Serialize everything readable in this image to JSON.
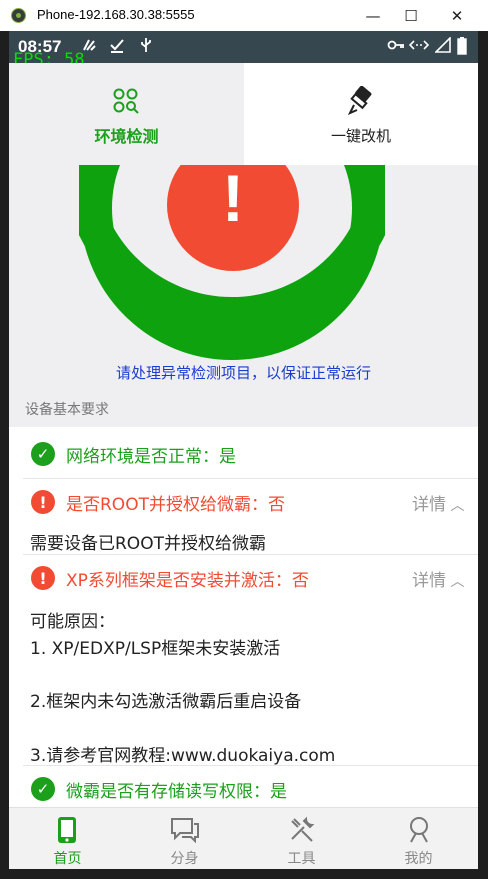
{
  "window": {
    "title": "Phone-192.168.30.38:5555",
    "minimize": "—",
    "maximize": "☐",
    "close": "✕"
  },
  "status_bar": {
    "time": "08:57",
    "fps": "FPS: 58"
  },
  "tabs": [
    {
      "label": "环境检测",
      "icon": "scan-icon",
      "active": true
    },
    {
      "label": "一键改机",
      "icon": "brush-icon",
      "active": false
    }
  ],
  "gauge": {
    "symbol": "!",
    "ring_color": "#0ea20e",
    "alert_color": "#f24b34",
    "message": "请处理异常检测项目，以保证正常运行"
  },
  "section": {
    "title": "设备基本要求"
  },
  "checks": [
    {
      "status": "ok",
      "text": "网络环境是否正常：是"
    },
    {
      "status": "error",
      "text": "是否ROOT并授权给微霸：否",
      "detail_label": "详情",
      "body": [
        "需要设备已ROOT并授权给微霸"
      ]
    },
    {
      "status": "error",
      "text": "XP系列框架是否安装并激活：否",
      "detail_label": "详情",
      "body": [
        "可能原因：",
        "1. XP/EDXP/LSP框架未安装激活",
        "2.框架内未勾选激活微霸后重启设备",
        "3.请参考官网教程:www.duokaiya.com"
      ]
    },
    {
      "status": "ok",
      "text": "微霸是否有存储读写权限：是"
    }
  ],
  "bottom_nav": [
    {
      "label": "首页",
      "icon": "phone-icon",
      "active": true
    },
    {
      "label": "分身",
      "icon": "chat-icon",
      "active": false
    },
    {
      "label": "工具",
      "icon": "tools-icon",
      "active": false
    },
    {
      "label": "我的",
      "icon": "person-icon",
      "active": false
    }
  ],
  "colors": {
    "accent": "#1ca01c",
    "error": "#f24b34",
    "status_bar": "#37474f"
  }
}
